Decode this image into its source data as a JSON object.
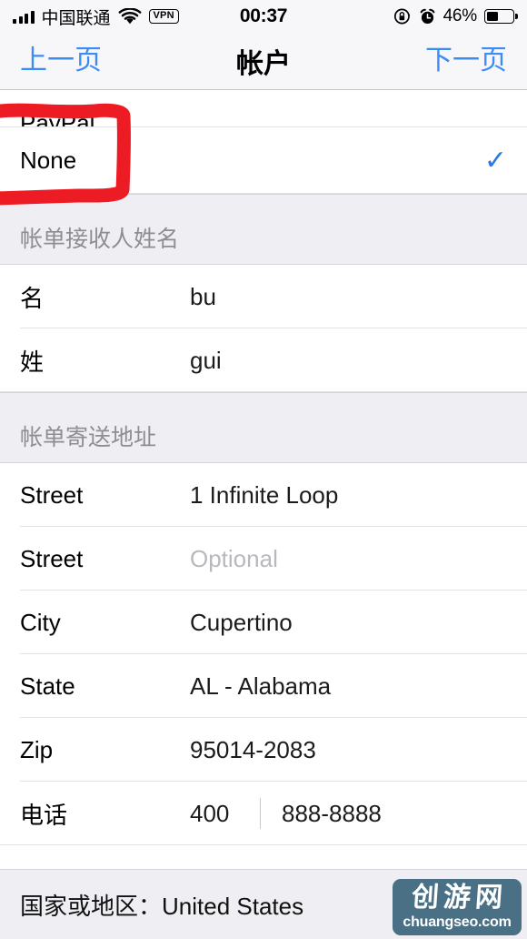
{
  "status_bar": {
    "carrier": "中国联通",
    "signal_icon": "signal-bars-icon",
    "wifi_icon": "wifi-icon",
    "vpn_label": "VPN",
    "time": "00:37",
    "rotation_lock_icon": "rotation-lock-icon",
    "alarm_icon": "alarm-clock-icon",
    "battery_percent": "46%",
    "battery_icon": "battery-icon",
    "battery_level": 46
  },
  "nav_bar": {
    "back_label": "上一页",
    "title": "帐户",
    "next_label": "下一页"
  },
  "payment_section": {
    "clipped_row_label": "PayPal",
    "none_row": {
      "label": "None",
      "checkmark": "✓",
      "selected": true
    }
  },
  "name_section": {
    "header": "帐单接收人姓名",
    "rows": [
      {
        "label": "名",
        "value": "bu"
      },
      {
        "label": "姓",
        "value": "gui"
      }
    ]
  },
  "address_section": {
    "header": "帐单寄送地址",
    "rows": [
      {
        "label": "Street",
        "value": "1 Infinite Loop",
        "is_placeholder": false
      },
      {
        "label": "Street",
        "value": "Optional",
        "is_placeholder": true
      },
      {
        "label": "City",
        "value": "Cupertino",
        "is_placeholder": false
      },
      {
        "label": "State",
        "value": "AL - Alabama",
        "is_placeholder": false
      },
      {
        "label": "Zip",
        "value": "95014-2083",
        "is_placeholder": false
      }
    ],
    "phone_row": {
      "label": "电话",
      "country_code": "400",
      "number": "888-8888"
    }
  },
  "footer": {
    "country_label": "国家或地区：",
    "country_value": "United States",
    "country_full": "国家或地区：United States"
  },
  "annotation": {
    "shape": "hand-drawn-rectangle",
    "color": "#ED1C24",
    "targets": "None"
  },
  "watermark": {
    "chinese": "创游网",
    "url": "chuangseo.com",
    "background_color": "#4a7086"
  },
  "colors": {
    "accent_blue": "#3c8cf6",
    "check_blue": "#2a7ae2",
    "group_gray": "#efeef3",
    "separator": "#e2e1e6",
    "placeholder_gray": "#b9b9bd",
    "annotation_red": "#ED1C24"
  }
}
